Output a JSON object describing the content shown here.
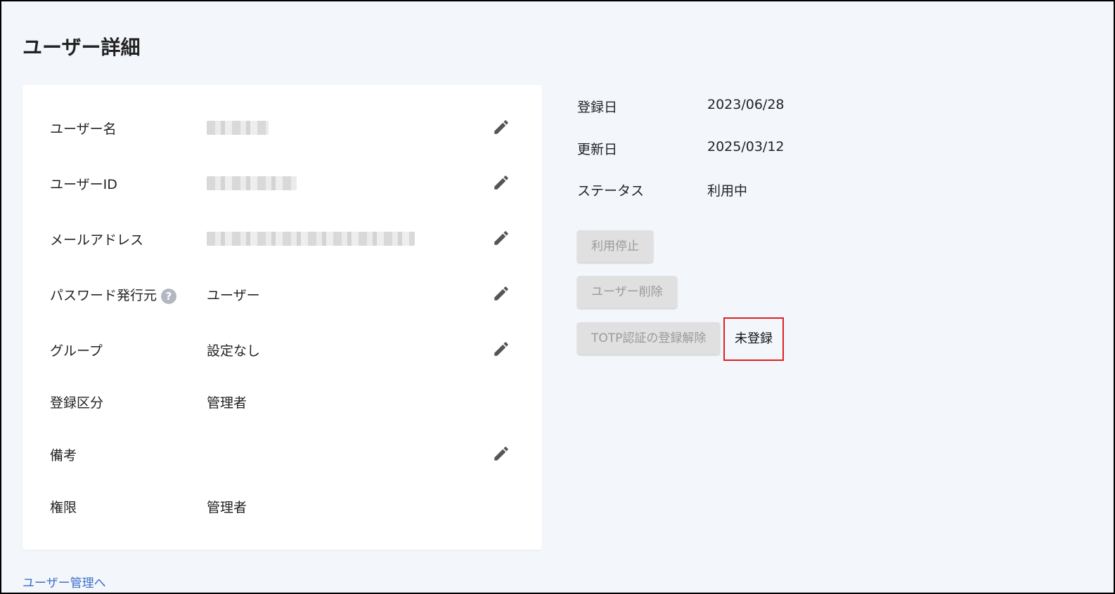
{
  "page": {
    "title": "ユーザー詳細"
  },
  "details": {
    "username": {
      "label": "ユーザー名",
      "value": ""
    },
    "user_id": {
      "label": "ユーザーID",
      "value": ""
    },
    "email": {
      "label": "メールアドレス",
      "value": ""
    },
    "password_issuer": {
      "label": "パスワード発行元",
      "help": "?",
      "value": "ユーザー"
    },
    "group": {
      "label": "グループ",
      "value": "設定なし"
    },
    "registration_type": {
      "label": "登録区分",
      "value": "管理者"
    },
    "notes": {
      "label": "備考",
      "value": ""
    },
    "permission": {
      "label": "権限",
      "value": "管理者"
    }
  },
  "meta": {
    "registered": {
      "label": "登録日",
      "value": "2023/06/28"
    },
    "updated": {
      "label": "更新日",
      "value": "2025/03/12"
    },
    "status": {
      "label": "ステータス",
      "value": "利用中"
    }
  },
  "actions": {
    "suspend_label": "利用停止",
    "delete_label": "ユーザー削除",
    "totp_unregister_label": "TOTP認証の登録解除",
    "totp_status": "未登録"
  },
  "footer": {
    "back_link": "ユーザー管理へ"
  },
  "colors": {
    "background": "#f3f6fb",
    "link": "#3d6fc9",
    "highlight": "#e02020",
    "disabled_button": "#e0e0e0"
  },
  "icons": {
    "edit": "pencil-icon",
    "help": "help-circle-icon"
  }
}
